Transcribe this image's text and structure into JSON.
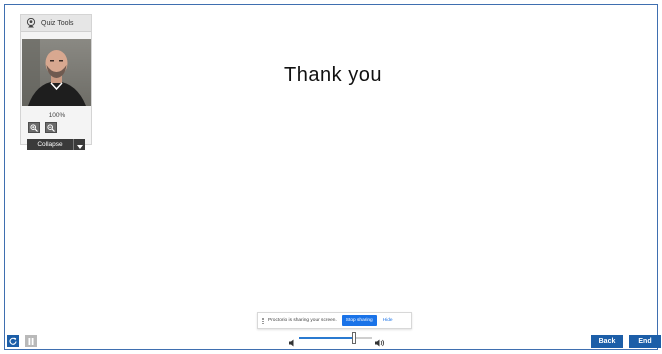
{
  "quiz_tools": {
    "title": "Quiz Tools",
    "zoom_level": "100%",
    "collapse_label": "Collapse"
  },
  "main": {
    "message": "Thank you"
  },
  "share_bar": {
    "message": "Proctorio is sharing your screen.",
    "stop_label": "Stop sharing",
    "hide_label": "Hide"
  },
  "volume": {
    "level": 0.75
  },
  "nav": {
    "back_label": "Back",
    "end_label": "End"
  },
  "colors": {
    "accent": "#1c5ea8",
    "share_blue": "#1a73e8",
    "volume_fill": "#2a7ad0"
  },
  "icons": {
    "quiz_tools": "proctorio-logo-icon",
    "zoom_in": "zoom-in-icon",
    "zoom_out": "zoom-out-icon",
    "dropdown": "chevron-down-icon",
    "mute": "volume-low-icon",
    "loud": "volume-high-icon",
    "reload": "reload-icon",
    "pause": "pause-icon"
  }
}
